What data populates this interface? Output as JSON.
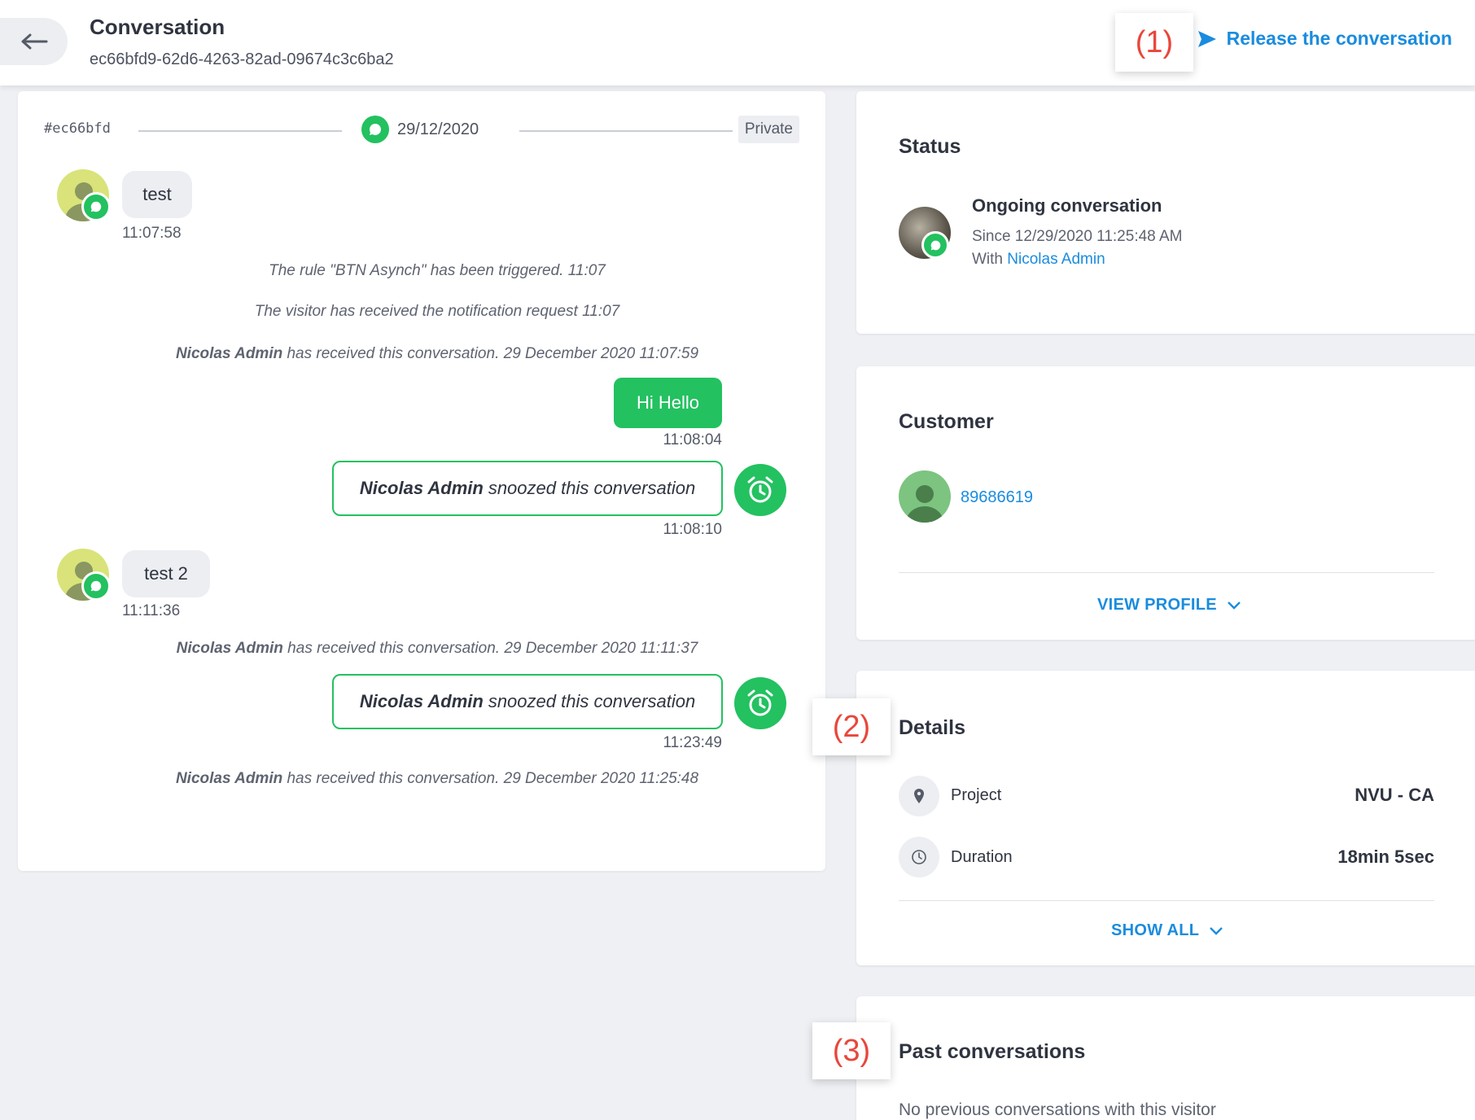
{
  "header": {
    "title": "Conversation",
    "subtitle": "ec66bfd9-62d6-4263-82ad-09674c3c6ba2",
    "release_label": "Release the conversation"
  },
  "callouts": [
    "(1)",
    "(2)",
    "(3)"
  ],
  "chat": {
    "conversation_id": "#ec66bfd",
    "date": "29/12/2020",
    "visibility": "Private",
    "messages": [
      {
        "text": "test",
        "time": "11:07:58"
      },
      {
        "text": "test 2",
        "time": "11:11:36"
      }
    ],
    "system": [
      {
        "text": "The rule \"BTN Asynch\" has been triggered.   11:07"
      },
      {
        "text": "The visitor has received the notification request   11:07"
      },
      {
        "actor": "Nicolas Admin",
        "text": " has received this conversation. 29 December 2020 11:07:59"
      },
      {
        "actor": "Nicolas Admin",
        "text": " has received this conversation. 29 December 2020 11:11:37"
      },
      {
        "actor": "Nicolas Admin",
        "text": " has received this conversation. 29 December 2020 11:25:48"
      }
    ],
    "agent_reply": {
      "text": "Hi Hello",
      "time": "11:08:04"
    },
    "snoozes": [
      {
        "actor": "Nicolas Admin",
        "text": "snoozed this conversation",
        "time": "11:08:10"
      },
      {
        "actor": "Nicolas Admin",
        "text": "snoozed this conversation",
        "time": "11:23:49"
      }
    ]
  },
  "status": {
    "title": "Status",
    "state": "Ongoing conversation",
    "since": "Since 12/29/2020 11:25:48 AM",
    "with_prefix": "With ",
    "with_agent": "Nicolas Admin"
  },
  "customer": {
    "title": "Customer",
    "id": "89686619",
    "view_profile": "VIEW PROFILE"
  },
  "details": {
    "title": "Details",
    "rows": [
      {
        "label": "Project",
        "value": "NVU - CA",
        "icon": "location-pin-icon"
      },
      {
        "label": "Duration",
        "value": "18min 5sec",
        "icon": "clock-icon"
      }
    ],
    "show_all": "SHOW ALL"
  },
  "past": {
    "title": "Past conversations",
    "empty": "No previous conversations with this visitor"
  },
  "colors": {
    "accent": "#1a8cde",
    "green": "#23c160",
    "callout": "#e8473b"
  }
}
